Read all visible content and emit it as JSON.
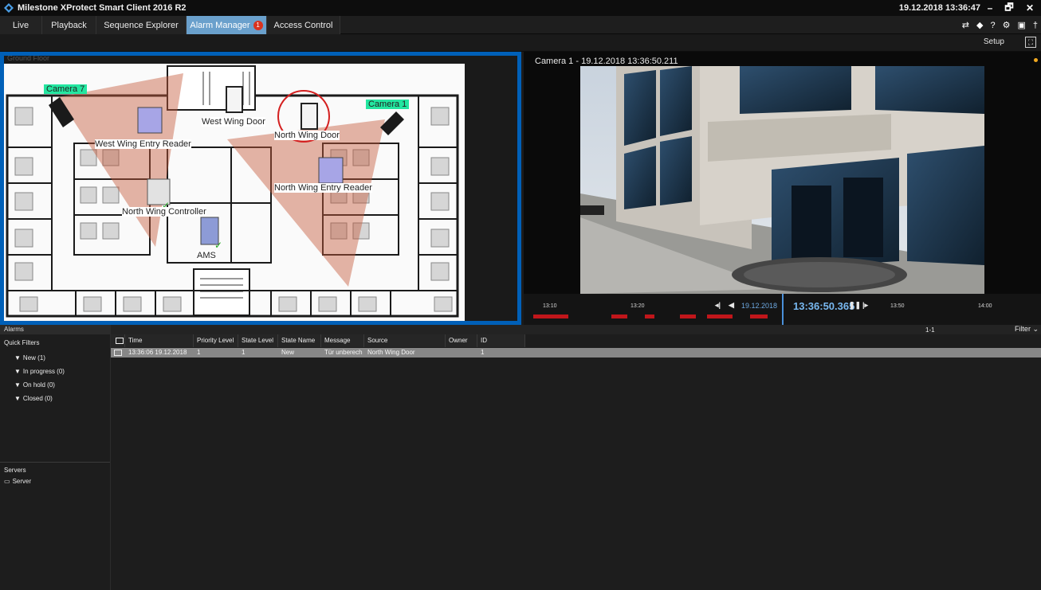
{
  "app": {
    "title": "Milestone XProtect Smart Client 2016 R2",
    "clock": "19.12.2018 13:36:47",
    "window_buttons": [
      "–",
      "🗗",
      "✕"
    ]
  },
  "tabs": [
    {
      "label": "Live"
    },
    {
      "label": "Playback"
    },
    {
      "label": "Sequence Explorer"
    },
    {
      "label": "Alarm Manager",
      "badge": "1"
    },
    {
      "label": "Access Control"
    }
  ],
  "toolbar": {
    "setup_label": "Setup"
  },
  "map": {
    "caption": "Ground Floor",
    "labels": {
      "camera7": "Camera 7",
      "camera1": "Camera 1",
      "west_door": "West Wing Door",
      "north_door": "North Wing Door",
      "west_reader": "West Wing Entry Reader",
      "north_reader": "North Wing Entry Reader",
      "north_controller": "North Wing Controller",
      "ams": "AMS"
    }
  },
  "camera": {
    "title": "Camera 1 - 19.12.2018 13:36:50.211"
  },
  "timeline": {
    "ticks": [
      "13:10",
      "13:20",
      "13:50",
      "14:00"
    ],
    "date": "19.12.2018",
    "current_time": "13:36:50.365"
  },
  "left_panel": {
    "alarms_header": "Alarms",
    "quick_filters_label": "Quick Filters",
    "filters": [
      {
        "label": "New (1)"
      },
      {
        "label": "In progress (0)"
      },
      {
        "label": "On hold (0)"
      },
      {
        "label": "Closed (0)"
      }
    ],
    "servers_label": "Servers",
    "server_item": "Server"
  },
  "alarm_table": {
    "page_count": "1-1",
    "filter_label": "Filter",
    "columns": [
      "Time",
      "Priority Level",
      "State Level",
      "State Name",
      "Message",
      "Source",
      "Owner",
      "ID"
    ],
    "rows": [
      [
        "13:36:06 19.12.2018",
        "1",
        "1",
        "New",
        "Tür unberech",
        "North Wing Door",
        "",
        "1"
      ]
    ]
  },
  "colors": {
    "accent": "#0060b8",
    "active_tab": "#6aa0cc",
    "alarm_badge": "#d9331f",
    "timeline_recording": "#c0161b"
  }
}
